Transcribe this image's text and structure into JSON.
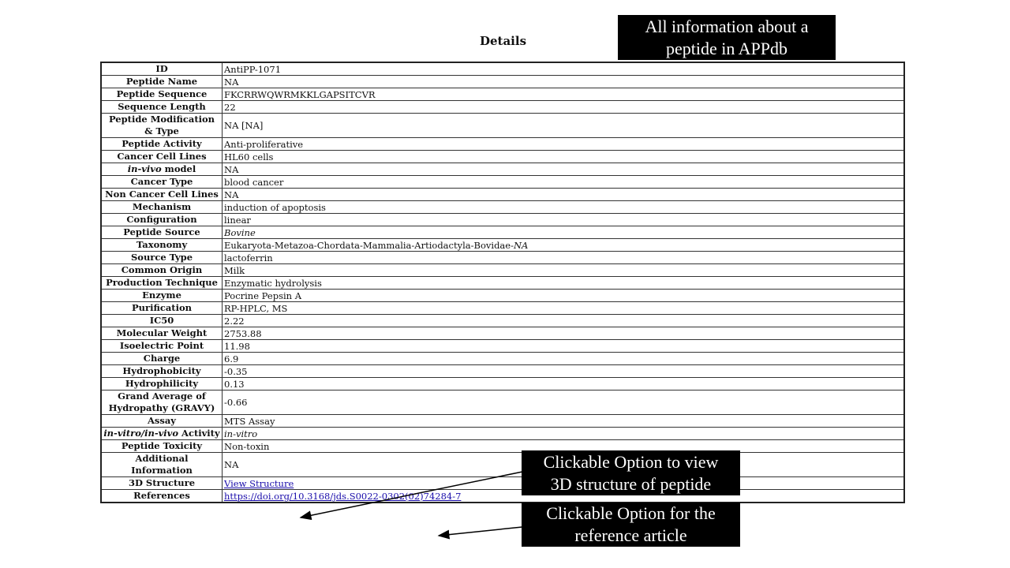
{
  "page": {
    "title": "Details"
  },
  "callouts": {
    "top": {
      "line1": "All information about a",
      "line2": "peptide in APPdb"
    },
    "structure": {
      "line1": "Clickable Option to view",
      "line2": "3D structure of peptide"
    },
    "reference": {
      "line1": "Clickable Option for the",
      "line2": "reference article"
    }
  },
  "rows": [
    {
      "key": "ID",
      "value": "AntiPP-1071"
    },
    {
      "key": "Peptide Name",
      "value": "NA"
    },
    {
      "key": "Peptide Sequence",
      "value": "FKCRRWQWRMKKLGAPSITCVR"
    },
    {
      "key": "Sequence Length",
      "value": "22"
    },
    {
      "key": "Peptide Modification & Type",
      "value": "NA [NA]"
    },
    {
      "key": "Peptide Activity",
      "value": "Anti-proliferative"
    },
    {
      "key": "Cancer Cell Lines",
      "value": "HL60 cells"
    },
    {
      "key_italic": "in-vivo",
      "key_rest": " model",
      "value": "NA"
    },
    {
      "key": "Cancer Type",
      "value": "blood cancer"
    },
    {
      "key": "Non Cancer Cell Lines",
      "value": "NA"
    },
    {
      "key": "Mechanism",
      "value": "induction of apoptosis"
    },
    {
      "key": "Configuration",
      "value": "linear"
    },
    {
      "key": "Peptide Source",
      "value": "Bovine"
    },
    {
      "key": "Taxonomy",
      "value": "Eukaryota-Metazoa-Chordata-Mammalia-Artiodactyla-Bovidae-",
      "value_italic": "NA"
    },
    {
      "key": "Source Type",
      "value": "lactoferrin"
    },
    {
      "key": "Common Origin",
      "value": "Milk"
    },
    {
      "key": "Production Technique",
      "value": "Enzymatic hydrolysis"
    },
    {
      "key": "Enzyme",
      "value": "Pocrine Pepsin A"
    },
    {
      "key": "Purification",
      "value": "RP-HPLC, MS"
    },
    {
      "key": "IC50",
      "value": "2.22"
    },
    {
      "key": "Molecular Weight",
      "value": "2753.88"
    },
    {
      "key": "Isoelectric Point",
      "value": "11.98"
    },
    {
      "key": "Charge",
      "value": "6.9"
    },
    {
      "key": "Hydrophobicity",
      "value": "-0.35"
    },
    {
      "key": "Hydrophilicity",
      "value": "0.13"
    },
    {
      "key": "Grand Average of Hydropathy (GRAVY)",
      "value": "-0.66"
    },
    {
      "key": "Assay",
      "value": "MTS Assay"
    },
    {
      "key_italic": "in-vitro/in-vivo",
      "key_rest": " Activity",
      "value": "in-vitro"
    },
    {
      "key": "Peptide Toxicity",
      "value": "Non-toxin"
    },
    {
      "key": "Additional Information",
      "value": "NA"
    },
    {
      "key": "3D Structure",
      "value": "View Structure"
    },
    {
      "key": "References",
      "value": "https://doi.org/10.3168/jds.S0022-0302(02)74284-7"
    }
  ]
}
